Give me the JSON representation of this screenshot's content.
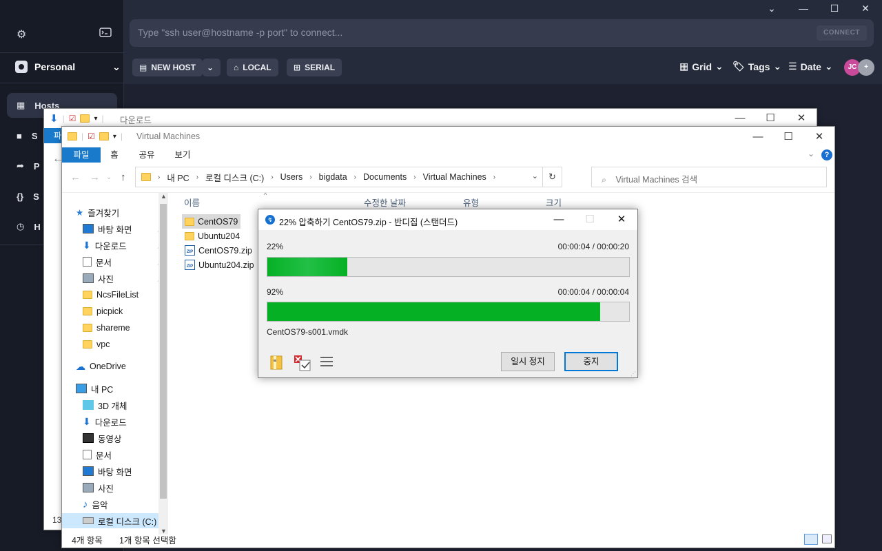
{
  "termius": {
    "profile": "Personal",
    "nav": [
      {
        "label": "Hosts",
        "abbr": "Hosts",
        "icon": "hosts-icon"
      },
      {
        "label": "SFTP",
        "abbr": "S",
        "icon": "folder-icon"
      },
      {
        "label": "Port Forwarding",
        "abbr": "P",
        "icon": "forward-icon"
      },
      {
        "label": "Snippets",
        "abbr": "S",
        "icon": "braces-icon"
      },
      {
        "label": "History",
        "abbr": "H",
        "icon": "clock-icon"
      }
    ],
    "search_placeholder": "Type \"ssh user@hostname -p port\" to connect...",
    "connect_label": "CONNECT",
    "buttons": {
      "new_host": "NEW HOST",
      "local": "LOCAL",
      "serial": "SERIAL"
    },
    "view": {
      "grid": "Grid",
      "tags": "Tags",
      "date": "Date"
    },
    "avatar_initials": "JC",
    "avatar_add": "+",
    "behind_status_fragment": "13",
    "colors": {
      "bg": "#171b26",
      "panel": "#252b3a",
      "accent_avatar": "#c94a9a"
    }
  },
  "back_window": {
    "title": "다운로드",
    "tab_fragment": "파"
  },
  "explorer": {
    "title": "Virtual Machines",
    "tabs": [
      "파일",
      "홈",
      "공유",
      "보기"
    ],
    "breadcrumb": [
      "내 PC",
      "로컬 디스크 (C:)",
      "Users",
      "bigdata",
      "Documents",
      "Virtual Machines"
    ],
    "search_placeholder": "Virtual Machines 검색",
    "tree": [
      {
        "label": "즐겨찾기",
        "icon": "star-icon",
        "pinned": false
      },
      {
        "label": "바탕 화면",
        "icon": "desktop-icon",
        "pinned": true
      },
      {
        "label": "다운로드",
        "icon": "download-icon",
        "pinned": true
      },
      {
        "label": "문서",
        "icon": "document-icon",
        "pinned": true
      },
      {
        "label": "사진",
        "icon": "picture-icon",
        "pinned": true
      },
      {
        "label": "NcsFileList",
        "icon": "folder-icon",
        "pinned": false
      },
      {
        "label": "picpick",
        "icon": "folder-icon",
        "pinned": false
      },
      {
        "label": "shareme",
        "icon": "folder-icon",
        "pinned": false
      },
      {
        "label": "vpc",
        "icon": "folder-icon",
        "pinned": false
      },
      {
        "label": "OneDrive",
        "icon": "cloud-icon",
        "pinned": false
      },
      {
        "label": "내 PC",
        "icon": "pc-icon",
        "pinned": false
      },
      {
        "label": "3D 개체",
        "icon": "cube-icon",
        "pinned": false
      },
      {
        "label": "다운로드",
        "icon": "download-icon",
        "pinned": false
      },
      {
        "label": "동영상",
        "icon": "video-icon",
        "pinned": false
      },
      {
        "label": "문서",
        "icon": "document-icon",
        "pinned": false
      },
      {
        "label": "바탕 화면",
        "icon": "desktop-icon",
        "pinned": false
      },
      {
        "label": "사진",
        "icon": "picture-icon",
        "pinned": false
      },
      {
        "label": "음악",
        "icon": "music-icon",
        "pinned": false
      },
      {
        "label": "로컬 디스크 (C:)",
        "icon": "drive-icon",
        "pinned": false
      }
    ],
    "columns": [
      "이름",
      "수정한 날짜",
      "유형",
      "크기"
    ],
    "files": [
      {
        "name": "CentOS79",
        "type": "folder"
      },
      {
        "name": "Ubuntu204",
        "type": "folder"
      },
      {
        "name": "CentOS79.zip",
        "type": "zip"
      },
      {
        "name": "Ubuntu204.zip",
        "type": "zip"
      }
    ],
    "status": {
      "count": "4개 항목",
      "selected": "1개 항목 선택함"
    }
  },
  "bandizip": {
    "title": "22% 압축하기 CentOS79.zip - 반디집 (스탠더드)",
    "overall": {
      "percent_label": "22%",
      "time": "00:00:04 / 00:00:20",
      "value": 0.22
    },
    "file": {
      "percent_label": "92%",
      "time": "00:00:04 / 00:00:04",
      "value": 0.92
    },
    "current_file": "CentOS79-s001.vmdk",
    "pause_label": "일시 정지",
    "stop_label": "중지",
    "progress_color": "#06b025"
  }
}
